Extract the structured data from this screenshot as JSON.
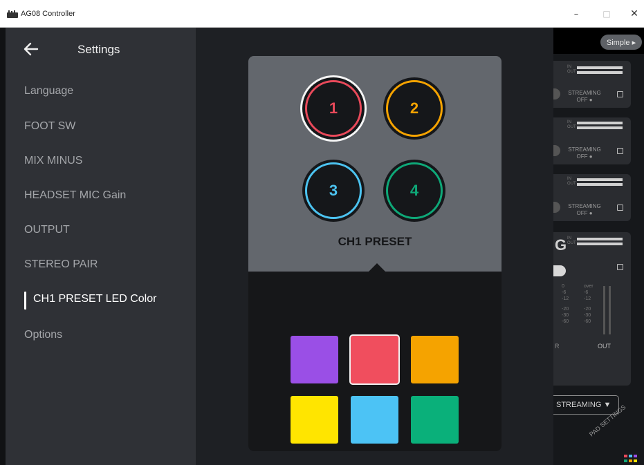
{
  "window": {
    "title": "AG08 Controller",
    "minimize_glyph": "–",
    "maximize_glyph": "□",
    "close_glyph": "✕"
  },
  "sidebar": {
    "title": "Settings",
    "back_icon": "arrow-left-icon",
    "items": [
      {
        "label": "Language",
        "active": false
      },
      {
        "label": "FOOT SW",
        "active": false
      },
      {
        "label": "MIX MINUS",
        "active": false
      },
      {
        "label": "HEADSET MIC Gain",
        "active": false
      },
      {
        "label": "OUTPUT",
        "active": false
      },
      {
        "label": "STEREO PAIR",
        "active": false
      },
      {
        "label": "CH1 PRESET LED Color",
        "active": true
      },
      {
        "label": "Options",
        "active": false
      }
    ]
  },
  "popup": {
    "presets": [
      {
        "label": "1",
        "color": "#e8495a",
        "selected": true
      },
      {
        "label": "2",
        "color": "#f5a300",
        "selected": false
      },
      {
        "label": "3",
        "color": "#4cc3f0",
        "selected": false
      },
      {
        "label": "4",
        "color": "#0ea878",
        "selected": false
      }
    ],
    "preset_label": "CH1 PRESET",
    "colors": [
      {
        "name": "purple",
        "hex": "#9a4fe6",
        "selected": false
      },
      {
        "name": "red",
        "hex": "#f04e5e",
        "selected": true
      },
      {
        "name": "orange",
        "hex": "#f5a300",
        "selected": false
      },
      {
        "name": "yellow",
        "hex": "#ffe500",
        "selected": false
      },
      {
        "name": "light-blue",
        "hex": "#4cc3f5",
        "selected": false
      },
      {
        "name": "green",
        "hex": "#0ab07a",
        "selected": false
      }
    ]
  },
  "background_panel": {
    "simple_button": "Simple ▸",
    "io_in": "IN",
    "io_out": "OUT",
    "streaming_label": "STREAMING",
    "streaming_state": "OFF ●",
    "scale_left": [
      "0",
      "-6",
      "-12",
      "-20",
      "-30",
      "-60"
    ],
    "scale_right": [
      "over",
      "-6",
      "-12",
      "-20",
      "-30",
      "-60"
    ],
    "r_label": "R",
    "out_label": "OUT",
    "stream_dropdown": "STREAMING ▼",
    "pad_settings": "PAD SETTINGS",
    "partial_letter": "G"
  }
}
